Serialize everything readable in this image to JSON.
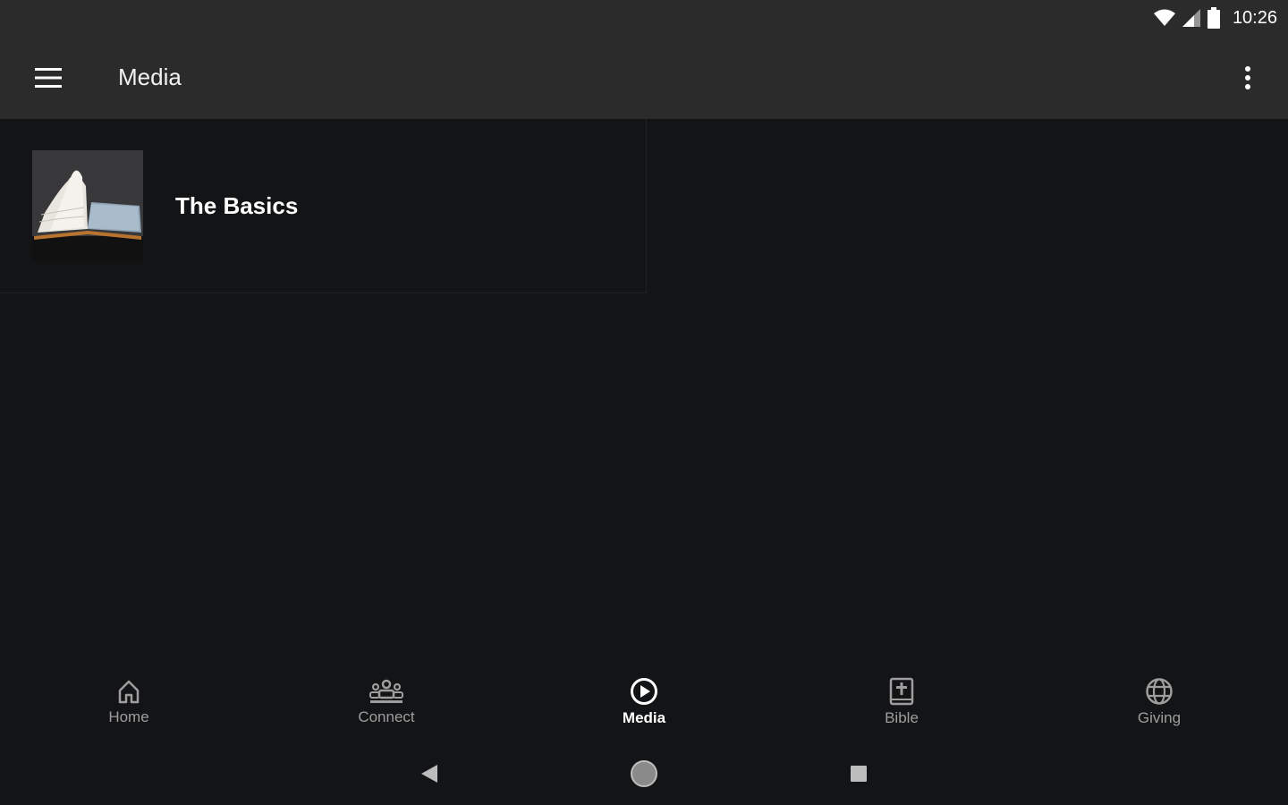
{
  "status_bar": {
    "time": "10:26",
    "icons": [
      "wifi-icon",
      "cell-signal-icon",
      "battery-icon"
    ]
  },
  "app_bar": {
    "title": "Media",
    "menu_icon": "hamburger-menu-icon",
    "more_icon": "more-vert-icon"
  },
  "media_list": [
    {
      "title": "The Basics",
      "thumbnail": "open-book-image"
    }
  ],
  "bottom_nav": {
    "items": [
      {
        "label": "Home",
        "icon": "home-icon",
        "active": false
      },
      {
        "label": "Connect",
        "icon": "group-icon",
        "active": false
      },
      {
        "label": "Media",
        "icon": "play-circle-icon",
        "active": true
      },
      {
        "label": "Bible",
        "icon": "bible-icon",
        "active": false
      },
      {
        "label": "Giving",
        "icon": "globe-icon",
        "active": false
      }
    ]
  },
  "colors": {
    "background": "#131416",
    "bars": "#2b2b2b",
    "inactive": "#9e9e9e",
    "active": "#ffffff"
  }
}
